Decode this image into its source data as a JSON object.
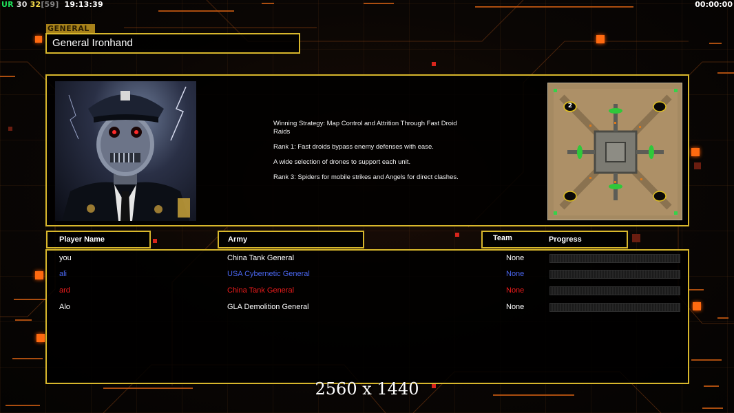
{
  "hud": {
    "ur_label": "UR",
    "value_a": "30",
    "value_b": "32",
    "value_c": "[59]",
    "clock": "19:13:39",
    "timer": "00:00:00"
  },
  "general": {
    "tag": "GENERAL",
    "name": "General Ironhand"
  },
  "strategy": [
    "Winning Strategy: Map Control and Attrition Through Fast Droid\n Raids",
    "Rank 1: Fast droids bypass enemy defenses with ease.",
    "A wide selection of drones to support each unit.",
    "Rank 3: Spiders for mobile strikes and Angels for direct clashes."
  ],
  "minimap": {
    "player_marker": "2"
  },
  "columns": {
    "player_name": "Player Name",
    "army": "Army",
    "team": "Team",
    "progress": "Progress"
  },
  "players": [
    {
      "name": "you",
      "army": "China Tank General",
      "team": "None",
      "color": "#ffffff",
      "progress": 0
    },
    {
      "name": "ali",
      "army": "USA Cybernetic General",
      "team": "None",
      "color": "#4a66ee",
      "progress": 0
    },
    {
      "name": "ard",
      "army": "China Tank General",
      "team": "None",
      "color": "#ee1c1c",
      "progress": 0
    },
    {
      "name": "Alo",
      "army": "GLA Demolition General",
      "team": "None",
      "color": "#ffffff",
      "progress": 0
    }
  ],
  "resolution": "2560 x 1440",
  "colors": {
    "frame": "#d8b72c",
    "accent_orange": "#ff6a10"
  }
}
